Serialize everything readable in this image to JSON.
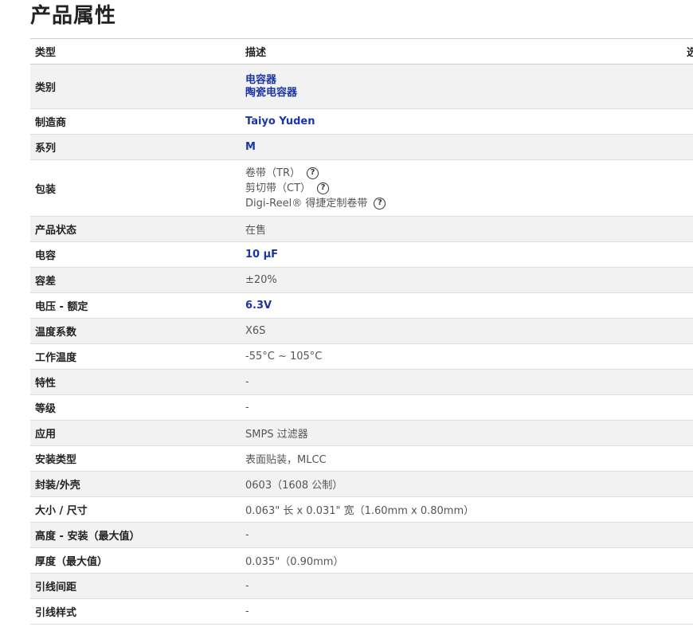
{
  "page": {
    "title": "产品属性"
  },
  "table": {
    "headers": [
      "类型",
      "描述",
      "选"
    ],
    "rows": [
      {
        "label": "类别",
        "links": [
          "电容器",
          "陶瓷电容器"
        ]
      },
      {
        "label": "制造商",
        "link": "Taiyo Yuden"
      },
      {
        "label": "系列",
        "link": "M"
      },
      {
        "label": "包装",
        "packaging": [
          "卷带（TR）",
          "剪切带（CT）",
          "Digi-Reel® 得捷定制卷带"
        ]
      },
      {
        "label": "产品状态",
        "value": "在售"
      },
      {
        "label": "电容",
        "link": "10 µF"
      },
      {
        "label": "容差",
        "value": "±20%"
      },
      {
        "label": "电压 - 额定",
        "link": "6.3V"
      },
      {
        "label": "温度系数",
        "value": "X6S"
      },
      {
        "label": "工作温度",
        "value": "-55°C ~ 105°C"
      },
      {
        "label": "特性",
        "value": "-"
      },
      {
        "label": "等级",
        "value": "-"
      },
      {
        "label": "应用",
        "value": "SMPS 过滤器"
      },
      {
        "label": "安装类型",
        "value": "表面贴装，MLCC"
      },
      {
        "label": "封装/外壳",
        "value": "0603（1608 公制）"
      },
      {
        "label": "大小 / 尺寸",
        "value": "0.063\" 长 x 0.031\" 宽（1.60mm x 0.80mm）"
      },
      {
        "label": "高度 - 安装（最大值）",
        "value": "-"
      },
      {
        "label": "厚度（最大值）",
        "value": "0.035\"（0.90mm）"
      },
      {
        "label": "引线间距",
        "value": "-"
      },
      {
        "label": "引线样式",
        "value": "-"
      }
    ]
  },
  "icons": {
    "help": "question-circle-icon",
    "help_glyph": "?"
  },
  "colors": {
    "link": "#1a35a8",
    "row_alt_bg": "#f2f2f2"
  }
}
